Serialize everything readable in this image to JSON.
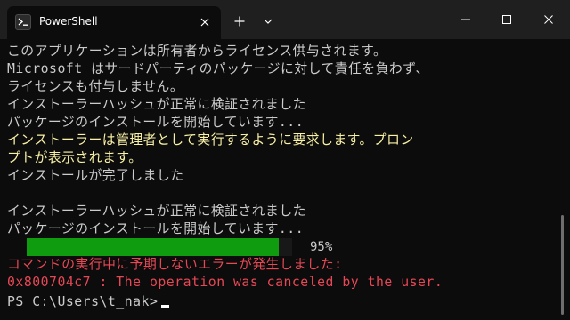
{
  "colors": {
    "background": "#0c0c0c",
    "titlebar": "#1f1f1f",
    "text_default": "#cccccc",
    "text_warning": "#f9f1a5",
    "text_error": "#e74856",
    "progress": "#0f9d0f"
  },
  "titlebar": {
    "tab_title": "PowerShell",
    "tab_icon": "powershell-icon",
    "close_tab_icon": "close-icon",
    "new_tab_label": "+",
    "dropdown_icon": "chevron-down-icon",
    "minimize_icon": "minimize-icon",
    "maximize_icon": "maximize-icon",
    "close_window_icon": "close-icon"
  },
  "terminal": {
    "lines": [
      {
        "text": "このアプリケーションは所有者からライセンス供与されます。",
        "style": "default"
      },
      {
        "text": "Microsoft はサードパーティのパッケージに対して責任を負わず、",
        "style": "default"
      },
      {
        "text": "ライセンスも付与しません。",
        "style": "default"
      },
      {
        "text": "インストーラーハッシュが正常に検証されました",
        "style": "default"
      },
      {
        "text": "パッケージのインストールを開始しています...",
        "style": "default"
      },
      {
        "text": "インストーラーは管理者として実行するように要求します。プロン",
        "style": "yellow"
      },
      {
        "text": "プトが表示されます。",
        "style": "yellow"
      },
      {
        "text": "インストールが完了しました",
        "style": "default"
      },
      {
        "text": "",
        "style": "default"
      },
      {
        "text": "インストーラーハッシュが正常に検証されました",
        "style": "default"
      },
      {
        "text": "パッケージのインストールを開始しています...",
        "style": "default"
      }
    ],
    "progress": {
      "fraction": 0.95,
      "label": "95%"
    },
    "error_lines": [
      {
        "text": "コマンドの実行中に予期しないエラーが発生しました:",
        "style": "red"
      },
      {
        "text": "0x800704c7 : The operation was canceled by the user.",
        "style": "red"
      }
    ],
    "prompt": "PS C:\\Users\\t_nak>"
  }
}
